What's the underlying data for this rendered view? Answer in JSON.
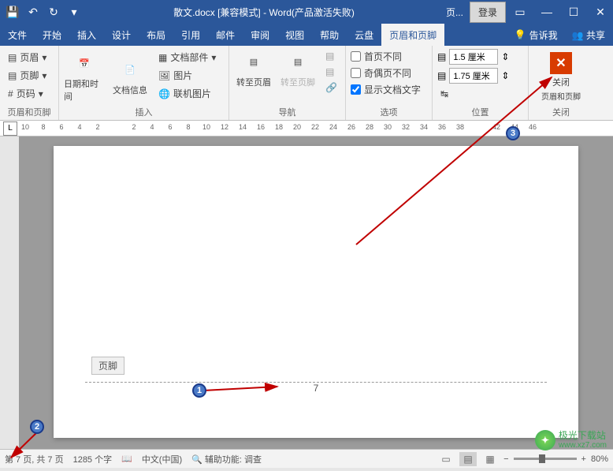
{
  "title": "散文.docx [兼容模式] - Word(产品激活失败)",
  "title_context": "页...",
  "login": "登录",
  "menu": [
    "文件",
    "开始",
    "插入",
    "设计",
    "布局",
    "引用",
    "邮件",
    "审阅",
    "视图",
    "帮助",
    "云盘",
    "页眉和页脚"
  ],
  "active_menu": 11,
  "tell_me": "告诉我",
  "share": "共享",
  "ribbon": {
    "g1": {
      "items": [
        "页眉",
        "页脚",
        "页码"
      ],
      "label": "页眉和页脚"
    },
    "g2": {
      "date": "日期和时间",
      "docinfo": "文档信息",
      "parts": "文档部件",
      "pic": "图片",
      "online": "联机图片",
      "label": "插入"
    },
    "g3": {
      "gohdr": "转至页眉",
      "goftr": "转至页脚",
      "label": "导航"
    },
    "g4": {
      "c1": "首页不同",
      "c2": "奇偶页不同",
      "c3": "显示文档文字",
      "label": "选项"
    },
    "g5": {
      "v1": "1.5 厘米",
      "v2": "1.75 厘米",
      "label": "位置"
    },
    "g6": {
      "close": "关闭",
      "sub": "页眉和页脚",
      "label": "关闭"
    }
  },
  "ruler_nums": [
    "10",
    "8",
    "6",
    "4",
    "2",
    "",
    "2",
    "4",
    "6",
    "8",
    "10",
    "12",
    "14",
    "16",
    "18",
    "20",
    "22",
    "24",
    "26",
    "28",
    "30",
    "32",
    "34",
    "36",
    "38",
    "",
    "42",
    "44",
    "46"
  ],
  "footer_tag": "页脚",
  "page_number": "7",
  "circles": [
    "1",
    "2",
    "3"
  ],
  "status": {
    "page": "第 7 页, 共 7 页",
    "words": "1285 个字",
    "lang": "中文(中国)",
    "access": "辅助功能: 调查",
    "zoom": "80%"
  },
  "watermark": {
    "title": "极光下载站",
    "url": "www.xz7.com"
  }
}
